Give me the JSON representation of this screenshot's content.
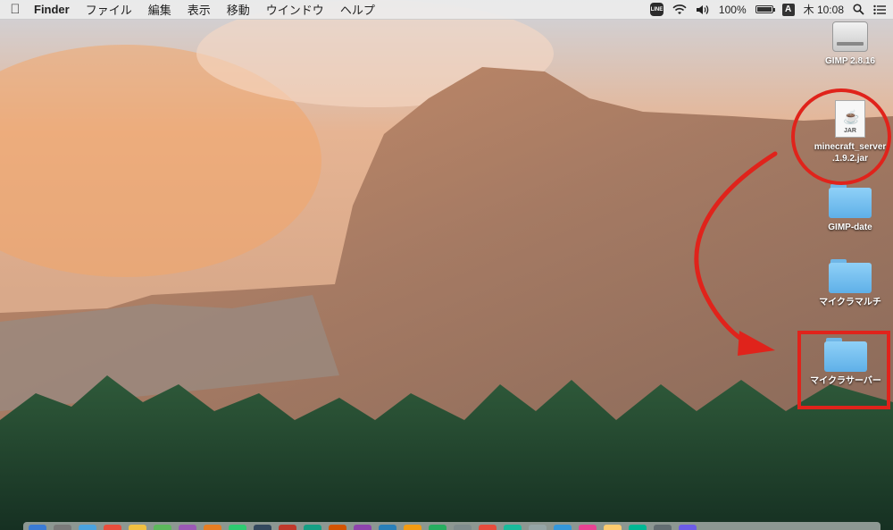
{
  "menubar": {
    "apple_icon": "apple-icon",
    "items": [
      "Finder",
      "ファイル",
      "編集",
      "表示",
      "移動",
      "ウインドウ",
      "ヘルプ"
    ],
    "status": {
      "line_label": "LINE",
      "battery": "100%",
      "battery_level": 1.0,
      "input_source": "A",
      "clock": "木 10:08",
      "icons": [
        "wifi-icon",
        "volume-icon",
        "spotlight-icon",
        "notification-icon"
      ]
    }
  },
  "desktop_icons": {
    "gimp_drive": "GIMP 2.8.16",
    "jar_file_line1": "minecraft_server",
    "jar_file_line2": ".1.9.2.jar",
    "jar_tag": "JAR",
    "folder_gimp_date": "GIMP-date",
    "folder_maikura_multi": "マイクラマルチ",
    "folder_maikura_server": "マイクラサーバー"
  },
  "annotation": {
    "color": "#e0231b"
  },
  "dock": {
    "app_colors": [
      "#3a7bd5",
      "#7a7a7a",
      "#4aa3df",
      "#e94e3c",
      "#f0c040",
      "#5cb85c",
      "#9b59b6",
      "#e67e22",
      "#2ecc71",
      "#34495e",
      "#c0392b",
      "#16a085",
      "#d35400",
      "#8e44ad",
      "#2980b9",
      "#f39c12",
      "#27ae60",
      "#7f8c8d",
      "#e74c3c",
      "#1abc9c",
      "#95a5a6",
      "#3498db",
      "#e84393",
      "#fdcb6e",
      "#00b894",
      "#636e72",
      "#6c5ce7"
    ]
  }
}
